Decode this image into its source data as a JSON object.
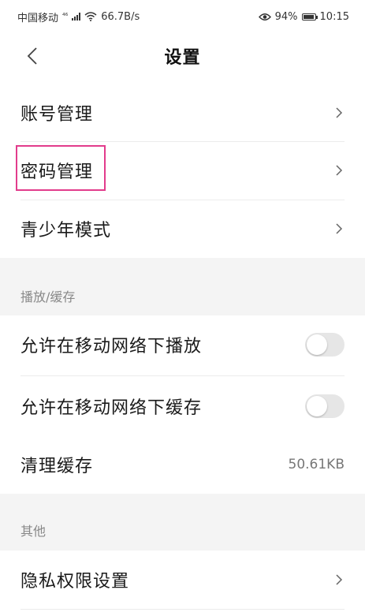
{
  "status_bar": {
    "carrier": "中国移动",
    "net_type": "⁴⁶",
    "speed": "66.7B/s",
    "eye_icon": "eye-icon",
    "battery": "94%",
    "battery_level": 0.94,
    "time": "10:15"
  },
  "nav": {
    "title": "设置",
    "back_icon": "chevron-left-icon"
  },
  "account": [
    {
      "label": "账号管理"
    },
    {
      "label": "密码管理"
    },
    {
      "label": "青少年模式"
    }
  ],
  "sections": {
    "playback": "播放/缓存",
    "other": "其他"
  },
  "playback": {
    "allow_play_mobile": {
      "label": "允许在移动网络下播放",
      "enabled": false
    },
    "allow_cache_mobile": {
      "label": "允许在移动网络下缓存",
      "enabled": false
    },
    "clear_cache": {
      "label": "清理缓存",
      "value": "50.61KB"
    }
  },
  "other": [
    {
      "label": "隐私权限设置"
    }
  ],
  "colors": {
    "highlight": "#e23c8c",
    "section_bg": "#f4f4f4",
    "toggle_off": "#e6e6e6"
  }
}
